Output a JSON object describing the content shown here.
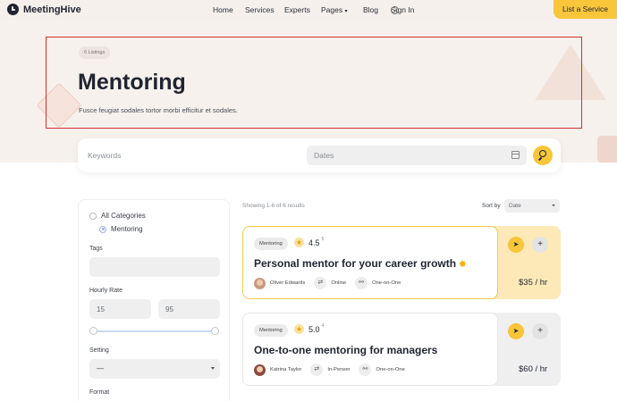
{
  "header": {
    "logo_text": "MeetingHive",
    "nav": [
      "Home",
      "Services",
      "Experts",
      "Pages",
      "Blog"
    ],
    "signin": "Sign In",
    "cta": "List a Service"
  },
  "hero": {
    "badge": "6 Listings",
    "title": "Mentoring",
    "subtitle": "Fusce feugiat sodales tortor morbi efficitur et sodales."
  },
  "search": {
    "keywords_placeholder": "Keywords",
    "dates_placeholder": "Dates"
  },
  "filters": {
    "categories": [
      {
        "label": "All Categories",
        "selected": false
      },
      {
        "label": "Mentoring",
        "selected": true
      }
    ],
    "tags_label": "Tags",
    "hourly_rate_label": "Hourly Rate",
    "rate_min": "15",
    "rate_max": "95",
    "setting_label": "Setting",
    "setting_value": "—",
    "format_label": "Format"
  },
  "results": {
    "count_text": "Showing 1-6 of 6 results",
    "sort_label": "Sort by",
    "sort_value": "Date",
    "items": [
      {
        "category": "Mentoring",
        "rating": "4.5",
        "rating_count": "5",
        "title": "Personal mentor for your career growth",
        "expert": "Oliver Edwards",
        "mode": "Online",
        "format": "One-on-One",
        "price": "$35 / hr"
      },
      {
        "category": "Mentoring",
        "rating": "5.0",
        "rating_count": "4",
        "title": "One-to-one mentoring for managers",
        "expert": "Katrina Taylor",
        "mode": "In-Person",
        "format": "One-on-One",
        "price": "$60 / hr"
      }
    ]
  }
}
